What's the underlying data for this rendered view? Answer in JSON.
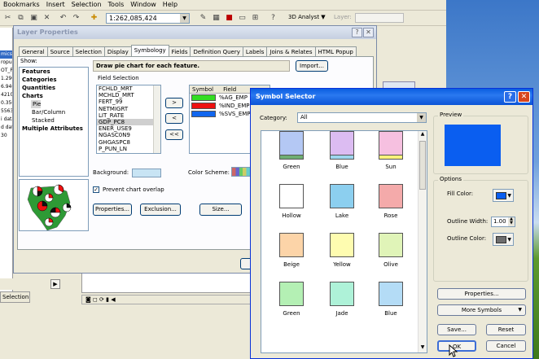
{
  "app": {
    "menu": [
      "Bookmarks",
      "Insert",
      "Selection",
      "Tools",
      "Window",
      "Help"
    ],
    "scale_value": "1:262,085,424",
    "analyst_menu": "3D Analyst ▼",
    "layer_label": "Layer:",
    "left_panel_lines": [
      "mics",
      "ropul",
      "OT_PC",
      "1.29C",
      "6.94C",
      "4210",
      "0.350",
      "5563",
      "i data",
      "d dat",
      "30"
    ],
    "selection_button": "Selection"
  },
  "layer_properties": {
    "title": "Layer Properties",
    "tabs": [
      "General",
      "Source",
      "Selection",
      "Display",
      "Symbology",
      "Fields",
      "Definition Query",
      "Labels",
      "Joins & Relates",
      "HTML Popup"
    ],
    "active_tab": "Symbology",
    "show_label": "Show:",
    "show_items": [
      {
        "text": "Features",
        "kind": "bold"
      },
      {
        "text": "Categories",
        "kind": "bold"
      },
      {
        "text": "Quantities",
        "kind": "bold"
      },
      {
        "text": "Charts",
        "kind": "bold"
      },
      {
        "text": "Pie",
        "kind": "selected"
      },
      {
        "text": "Bar/Column",
        "kind": "indent"
      },
      {
        "text": "Stacked",
        "kind": "indent"
      },
      {
        "text": "Multiple Attributes",
        "kind": "bold"
      }
    ],
    "heading": "Draw pie chart for each feature.",
    "import_button": "Import...",
    "field_selection_label": "Field Selection",
    "fields": [
      "FCHLD_MRT",
      "MCHLD_MRT",
      "FERT_99",
      "NETMIGRT",
      "LIT_RATE",
      "GDP_PC8",
      "ENER_USE9",
      "NGASC0N9",
      "GHGASPC8",
      "P_PUN_LN"
    ],
    "selected_field": "GDP_PC8",
    "move_right": ">",
    "move_left": "<",
    "move_all_left": "<<",
    "symbol_col": "Symbol",
    "field_col": "Field",
    "chart_fields": [
      {
        "field": "%AG_EMP",
        "color": "#33dd22"
      },
      {
        "field": "%IND_EMP",
        "color": "#ee1111"
      },
      {
        "field": "%SVS_EMP",
        "color": "#1166ee"
      }
    ],
    "background_label": "Background:",
    "background_color": "#c8e4f4",
    "color_scheme_label": "Color Scheme:",
    "prevent_overlap_label": "Prevent chart overlap",
    "prevent_overlap_checked": "✓",
    "properties_button": "Properties...",
    "exclusion_button": "Exclusion...",
    "size_button": "Size..."
  },
  "symbol_selector": {
    "title": "Symbol Selector",
    "help_glyph": "?",
    "close_glyph": "✕",
    "category_label": "Category:",
    "category_value": "All",
    "symbols": [
      {
        "name": "Green",
        "color": "#6fae72"
      },
      {
        "name": "Blue",
        "color": "#9dd6ee"
      },
      {
        "name": "Sun",
        "color": "#fbf27a"
      },
      {
        "name": "Hollow",
        "color": "#ffffff"
      },
      {
        "name": "Lake",
        "color": "#8ccfef"
      },
      {
        "name": "Rose",
        "color": "#f4aaaa"
      },
      {
        "name": "Beige",
        "color": "#fcd4a8"
      },
      {
        "name": "Yellow",
        "color": "#fefcb0"
      },
      {
        "name": "Olive",
        "color": "#e0f4b8"
      },
      {
        "name": "Green",
        "color": "#b4f0b4"
      },
      {
        "name": "Jade",
        "color": "#aef2d8"
      },
      {
        "name": "Blue",
        "color": "#b4dcf6"
      },
      {
        "name": "",
        "color": "#b4c8f4"
      },
      {
        "name": "",
        "color": "#dcbcf2"
      },
      {
        "name": "",
        "color": "#f6c0e0"
      }
    ],
    "preview_label": "Preview",
    "preview_color": "#0a5ef0",
    "options_label": "Options",
    "fill_color_label": "Fill Color:",
    "fill_color": "#0a5ef0",
    "outline_width_label": "Outline Width:",
    "outline_width": "1.00",
    "outline_color_label": "Outline Color:",
    "outline_color": "#6e6e6e",
    "properties_button": "Properties...",
    "more_symbols_button": "More Symbols",
    "save_button": "Save...",
    "reset_button": "Reset",
    "ok_button": "OK",
    "cancel_button": "Cancel"
  }
}
